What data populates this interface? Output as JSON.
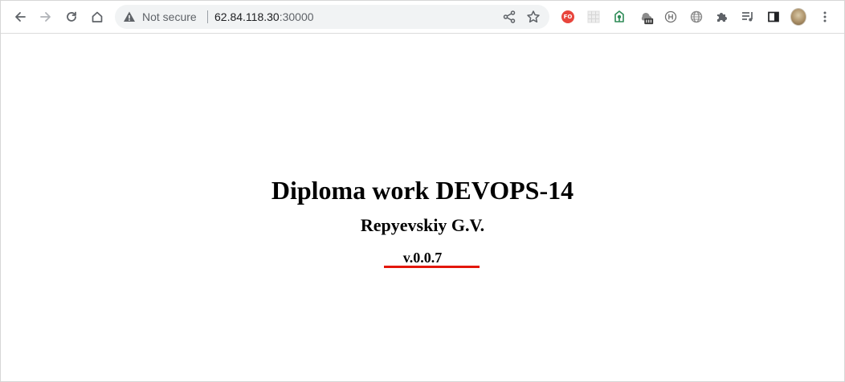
{
  "browser": {
    "security_label": "Not secure",
    "url_host": "62.84.118.30",
    "url_port": ":30000",
    "extension_badge": "FO"
  },
  "page": {
    "title": "Diploma work DEVOPS-14",
    "author": "Repyevskiy G.V.",
    "version": "v.0.0.7"
  },
  "colors": {
    "version_underline": "#e3170a",
    "fo_badge": "#e8453c"
  }
}
